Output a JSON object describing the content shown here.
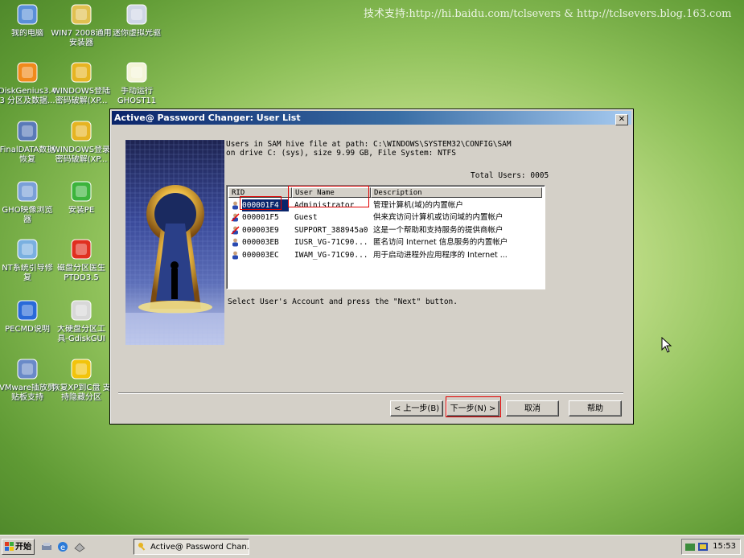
{
  "watermark": "技术支持:http://hi.baidu.com/tclsevers & http://tclsevers.blog.163.com",
  "desktop": {
    "icons": [
      {
        "label": "我的电脑",
        "icon": "computer-icon"
      },
      {
        "label": "WIN7 2008通用安装器",
        "icon": "installer-icon"
      },
      {
        "label": "迷你虚拟光驱",
        "icon": "virtual-drive-icon"
      },
      {
        "label": "DiskGenius3.4 3 分区及数据...",
        "icon": "diskgenius-icon"
      },
      {
        "label": "WINDOWS登陆 密码破解(XP...",
        "icon": "key-icon"
      },
      {
        "label": "手动运行 GHOST11",
        "icon": "ghost-icon"
      },
      {
        "label": "FinalDATA数据 恢复",
        "icon": "finaldata-icon"
      },
      {
        "label": "WINDOWS登录 密码破解(XP...",
        "icon": "key-icon"
      },
      {
        "label": "GHO映像浏览 器",
        "icon": "gho-viewer-icon"
      },
      {
        "label": "安装PE",
        "icon": "checkmark-icon"
      },
      {
        "label": "NT系统引导修 复",
        "icon": "nt-repair-icon"
      },
      {
        "label": "磁盘分区医生 PTDD3.5",
        "icon": "ptdd-icon"
      },
      {
        "label": "PECMD说明",
        "icon": "help-icon"
      },
      {
        "label": "大硬盘分区工 具-GdiskGUI",
        "icon": "gdisk-icon"
      },
      {
        "label": "VMware插放剪 贴板支持",
        "icon": "vmware-icon"
      },
      {
        "label": "恢复XP到C盘 支持隐藏分区",
        "icon": "windows-logo-icon"
      }
    ]
  },
  "window": {
    "title": "Active@ Password Changer: User List",
    "close_label": "✕",
    "info_line1": "Users in SAM hive file at path: C:\\WINDOWS\\SYSTEM32\\CONFIG\\SAM",
    "info_line2": "on drive C: (sys), size 9.99 GB, File System: NTFS",
    "total_users": "Total Users: 0005",
    "columns": [
      "RID",
      "User Name",
      "Description"
    ],
    "rows": [
      {
        "rid": "000001F4",
        "user": "Administrator",
        "desc": "管理计算机(域)的内置帐户"
      },
      {
        "rid": "000001F5",
        "user": "Guest",
        "desc": "供来宾访问计算机或访问域的内置帐户"
      },
      {
        "rid": "000003E9",
        "user": "SUPPORT_388945a0",
        "desc": "这是一个帮助和支持服务的提供商帐户"
      },
      {
        "rid": "000003EB",
        "user": "IUSR_VG-71C90...",
        "desc": "匿名访问 Internet 信息服务的内置帐户"
      },
      {
        "rid": "000003EC",
        "user": "IWAM_VG-71C90...",
        "desc": "用于启动进程外应用程序的 Internet ..."
      }
    ],
    "selected_row": 0,
    "hint": "Select User's Account and press the \"Next\" button.",
    "buttons": {
      "back": "< 上一步(B)",
      "next": "下一步(N) >",
      "cancel": "取消",
      "help": "帮助"
    }
  },
  "taskbar": {
    "start_label": "开始",
    "task_label": "Active@ Password Chan...",
    "clock": "15:53"
  }
}
